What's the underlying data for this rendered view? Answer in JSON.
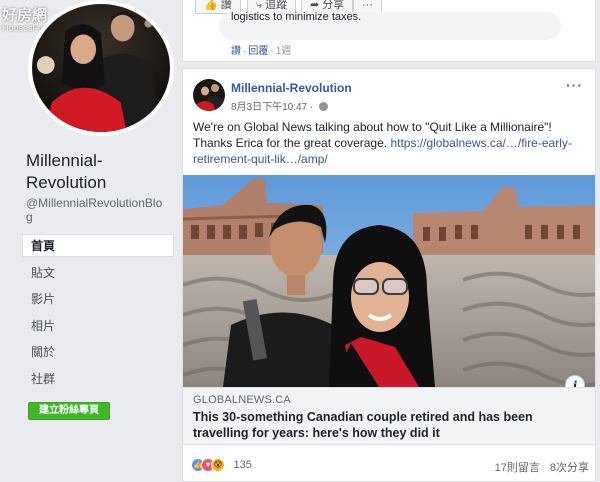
{
  "watermark": {
    "main": "好房網",
    "sub": "HousesFun News"
  },
  "page": {
    "name": "Millennial-Revolution",
    "handle": "@MillennialRevolutionBlog"
  },
  "nav": {
    "items": [
      {
        "label": "首頁",
        "active": true
      },
      {
        "label": "貼文"
      },
      {
        "label": "影片"
      },
      {
        "label": "相片"
      },
      {
        "label": "關於"
      },
      {
        "label": "社群"
      }
    ],
    "create_button": "建立粉絲專頁"
  },
  "top_card": {
    "like": "讚",
    "comment": "追蹤",
    "share": "分享",
    "more": "···",
    "comment_text": "logistics to minimize taxes.",
    "comment_like": "讚",
    "comment_reply": "回覆",
    "comment_time": "1週"
  },
  "post": {
    "author": "Millennial-Revolution",
    "timestamp": "8月3日下午10:47",
    "text": "We're on Global News talking about how to \"Quit Like a Millionaire\"! Thanks Erica for the great coverage.",
    "link_text": "https://globalnews.ca/…/fire-early-retirement-quit-lik…/amp/",
    "link_domain": "GLOBALNEWS.CA",
    "link_title": "This 30-something Canadian couple retired and has been travelling for years: here's how they did it",
    "reaction_count": "135",
    "comments": "17則留言",
    "shares": "8次分享"
  },
  "colors": {
    "link": "#385898",
    "accent_green": "#42b72a",
    "background": "#e9ebee"
  }
}
